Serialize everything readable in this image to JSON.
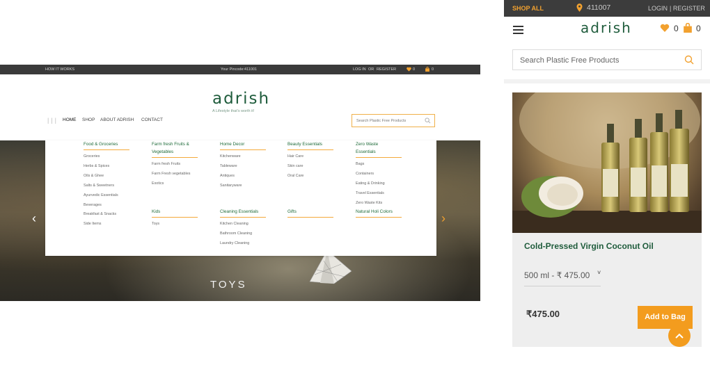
{
  "desktop": {
    "topbar": {
      "how_it_works": "HOW IT WORKS",
      "pincode": "Your Pincode:411001",
      "login": "LOG IN",
      "or": "OR",
      "register": "REGISTER",
      "wishlist_count": "0",
      "cart_count": "0"
    },
    "brand": {
      "logo": "adrish",
      "tagline": "A Lifestyle that's worth it!"
    },
    "nav": {
      "home": "HOME",
      "shop": "SHOP",
      "about": "ABOUT ADRISH",
      "contact": "CONTACT"
    },
    "search": {
      "placeholder": "Search Plastic Free Products"
    },
    "mega_menu": {
      "col1": {
        "heading": "Food & Groceries",
        "items": [
          "Groceries",
          "Herbs & Spices",
          "Oils & Ghee",
          "Salts & Sweetners",
          "Ayurvedic Essentials",
          "Beverages",
          "Breakfast & Snacks",
          "Side Items"
        ]
      },
      "col2": {
        "heading_line1": "Farm fresh Fruits &",
        "heading_line2": "Vegetables",
        "items": [
          "Farm fresh Fruits",
          "Farm Fresh vegetables",
          "Exotics"
        ]
      },
      "col2b": {
        "heading": "Kids",
        "items": [
          "Toys"
        ]
      },
      "col3": {
        "heading": "Home Decor",
        "items": [
          "Kitchenware",
          "Tableware",
          "Antiques",
          "Sanitaryware"
        ]
      },
      "col3b": {
        "heading": "Cleaning Essentials",
        "items": [
          "Kitchen Cleaning",
          "Bathroom Cleaning",
          "Laundry Cleaning"
        ]
      },
      "col4": {
        "heading": "Beauty Essentials",
        "items": [
          "Hair Care",
          "Skin care",
          "Oral Care"
        ]
      },
      "col4b": {
        "heading": "Gifts"
      },
      "col5": {
        "heading_line1": "Zero Waste",
        "heading_line2": "Essentials",
        "items": [
          "Bags",
          "Containers",
          "Eating & Drinking",
          "Travel Essentials",
          "Zero Waste Kits"
        ]
      },
      "col5b": {
        "heading": "Natural Holi Colors"
      }
    },
    "hero": {
      "caption": "TOYS"
    }
  },
  "mobile": {
    "topbar": {
      "shop_all": "SHOP ALL",
      "pincode": "411007",
      "login": "LOGIN",
      "register": "| REGISTER"
    },
    "header": {
      "logo": "adrish",
      "wishlist_count": "0",
      "cart_count": "0"
    },
    "search": {
      "placeholder": "Search Plastic Free Products"
    },
    "product": {
      "title": "Cold-Pressed Virgin Coconut Oil",
      "variant": "500 ml - ₹ 475.00",
      "price": "₹475.00",
      "add_to_bag": "Add to Bag"
    }
  },
  "colors": {
    "brand_green": "#1f5c3c",
    "accent_orange": "#f39c1e",
    "topbar_dark": "#3a3a3a"
  }
}
